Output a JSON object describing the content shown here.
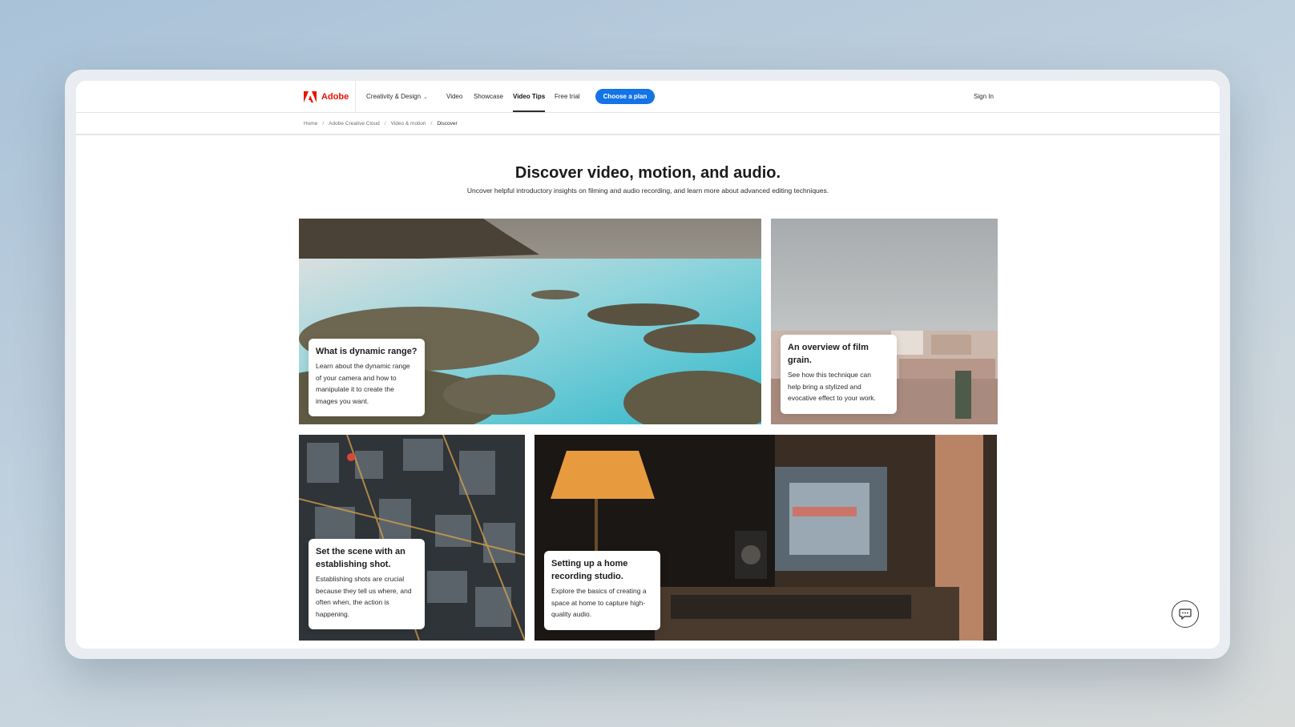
{
  "nav": {
    "brand": "Adobe",
    "items": [
      {
        "label": "Creativity & Design",
        "has_dropdown": true
      },
      {
        "label": "Video"
      },
      {
        "label": "Showcase"
      },
      {
        "label": "Video Tips",
        "active": true
      },
      {
        "label": "Free trial"
      }
    ],
    "cta_label": "Choose a plan",
    "sign_in": "Sign In"
  },
  "breadcrumb": [
    "Home",
    "Adobe Creative Cloud",
    "Video & motion",
    "Discover"
  ],
  "hero": {
    "title": "Discover video, motion, and audio.",
    "subtitle": "Uncover helpful introductory insights on filming and audio recording, and learn more about advanced editing techniques."
  },
  "cards": [
    {
      "title": "What is dynamic range?",
      "lines": [
        "Learn about the dynamic range",
        "of your camera and how to",
        "manipulate it to create the",
        "images you want."
      ],
      "image": "long-exposure-seascape"
    },
    {
      "title": [
        "An overview of film",
        "grain."
      ],
      "lines": [
        "See how this technique can",
        "help bring a stylized and",
        "evocative effect to your work."
      ],
      "image": "grainy-city-skyline"
    },
    {
      "title": [
        "Set the scene with an",
        "establishing shot."
      ],
      "lines": [
        "Establishing shots are crucial",
        "because they tell us where, and",
        "often when, the action is",
        "happening."
      ],
      "image": "aerial-city-night"
    },
    {
      "title": [
        "Setting up a home",
        "recording studio."
      ],
      "lines": [
        "Explore the basics of creating a",
        "space at home to capture high-",
        "quality audio."
      ],
      "image": "home-studio-desk"
    }
  ],
  "colors": {
    "brand_red": "#eb1000",
    "cta_blue": "#1473e6"
  },
  "icons": [
    "adobe-logo-icon",
    "chevron-down-icon",
    "chat-icon"
  ]
}
